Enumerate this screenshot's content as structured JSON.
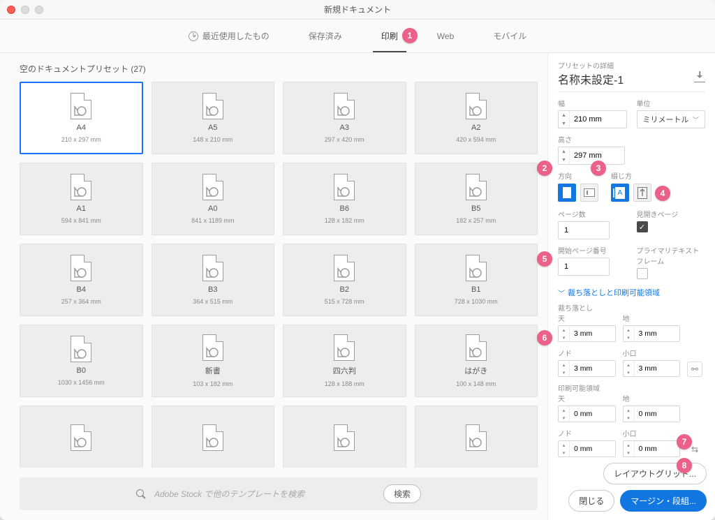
{
  "window": {
    "title": "新規ドキュメント"
  },
  "tabs": {
    "recent": "最近使用したもの",
    "saved": "保存済み",
    "print": "印刷",
    "web": "Web",
    "mobile": "モバイル"
  },
  "section_header": {
    "label": "空のドキュメントプリセット",
    "count": "(27)"
  },
  "presets": [
    {
      "name": "A4",
      "size": "210 x 297 mm",
      "selected": true
    },
    {
      "name": "A5",
      "size": "148 x 210 mm"
    },
    {
      "name": "A3",
      "size": "297 x 420 mm"
    },
    {
      "name": "A2",
      "size": "420 x 594 mm"
    },
    {
      "name": "A1",
      "size": "594 x 841 mm"
    },
    {
      "name": "A0",
      "size": "841 x 1189 mm"
    },
    {
      "name": "B6",
      "size": "128 x 182 mm"
    },
    {
      "name": "B5",
      "size": "182 x 257 mm"
    },
    {
      "name": "B4",
      "size": "257 x 364 mm"
    },
    {
      "name": "B3",
      "size": "364 x 515 mm"
    },
    {
      "name": "B2",
      "size": "515 x 728 mm"
    },
    {
      "name": "B1",
      "size": "728 x 1030 mm"
    },
    {
      "name": "B0",
      "size": "1030 x 1456 mm"
    },
    {
      "name": "新書",
      "size": "103 x 182 mm"
    },
    {
      "name": "四六判",
      "size": "128 x 188 mm"
    },
    {
      "name": "はがき",
      "size": "100 x 148 mm"
    },
    {
      "name": "",
      "size": ""
    },
    {
      "name": "",
      "size": ""
    },
    {
      "name": "",
      "size": ""
    },
    {
      "name": "",
      "size": ""
    }
  ],
  "search": {
    "placeholder": "Adobe Stock で他のテンプレートを検索",
    "button": "検索"
  },
  "details": {
    "heading": "プリセットの詳細",
    "name": "名称未設定-1",
    "width_label": "幅",
    "width": "210 mm",
    "units_label": "単位",
    "units": "ミリメートル",
    "height_label": "高さ",
    "height": "297 mm",
    "orientation_label": "方向",
    "binding_label": "綴じ方",
    "pages_label": "ページ数",
    "pages": "1",
    "facing_label": "見開きページ",
    "start_label": "開始ページ番号",
    "start": "1",
    "primary_tf_label": "プライマリテキストフレーム",
    "bleed_section": "裁ち落としと印刷可能領域",
    "bleed_label": "裁ち落とし",
    "top": "天",
    "bottom": "地",
    "inside": "ノド",
    "outside": "小口",
    "bleed_top": "3 mm",
    "bleed_bottom": "3 mm",
    "bleed_in": "3 mm",
    "bleed_out": "3 mm",
    "slug_label": "印刷可能領域",
    "slug_top": "0 mm",
    "slug_bottom": "0 mm",
    "slug_in": "0 mm",
    "slug_out": "0 mm"
  },
  "buttons": {
    "layout_grid": "レイアウトグリッド...",
    "close": "閉じる",
    "margins": "マージン・段組..."
  },
  "callouts": {
    "1": "1",
    "2": "2",
    "3": "3",
    "4": "4",
    "5": "5",
    "6": "6",
    "7": "7",
    "8": "8"
  }
}
